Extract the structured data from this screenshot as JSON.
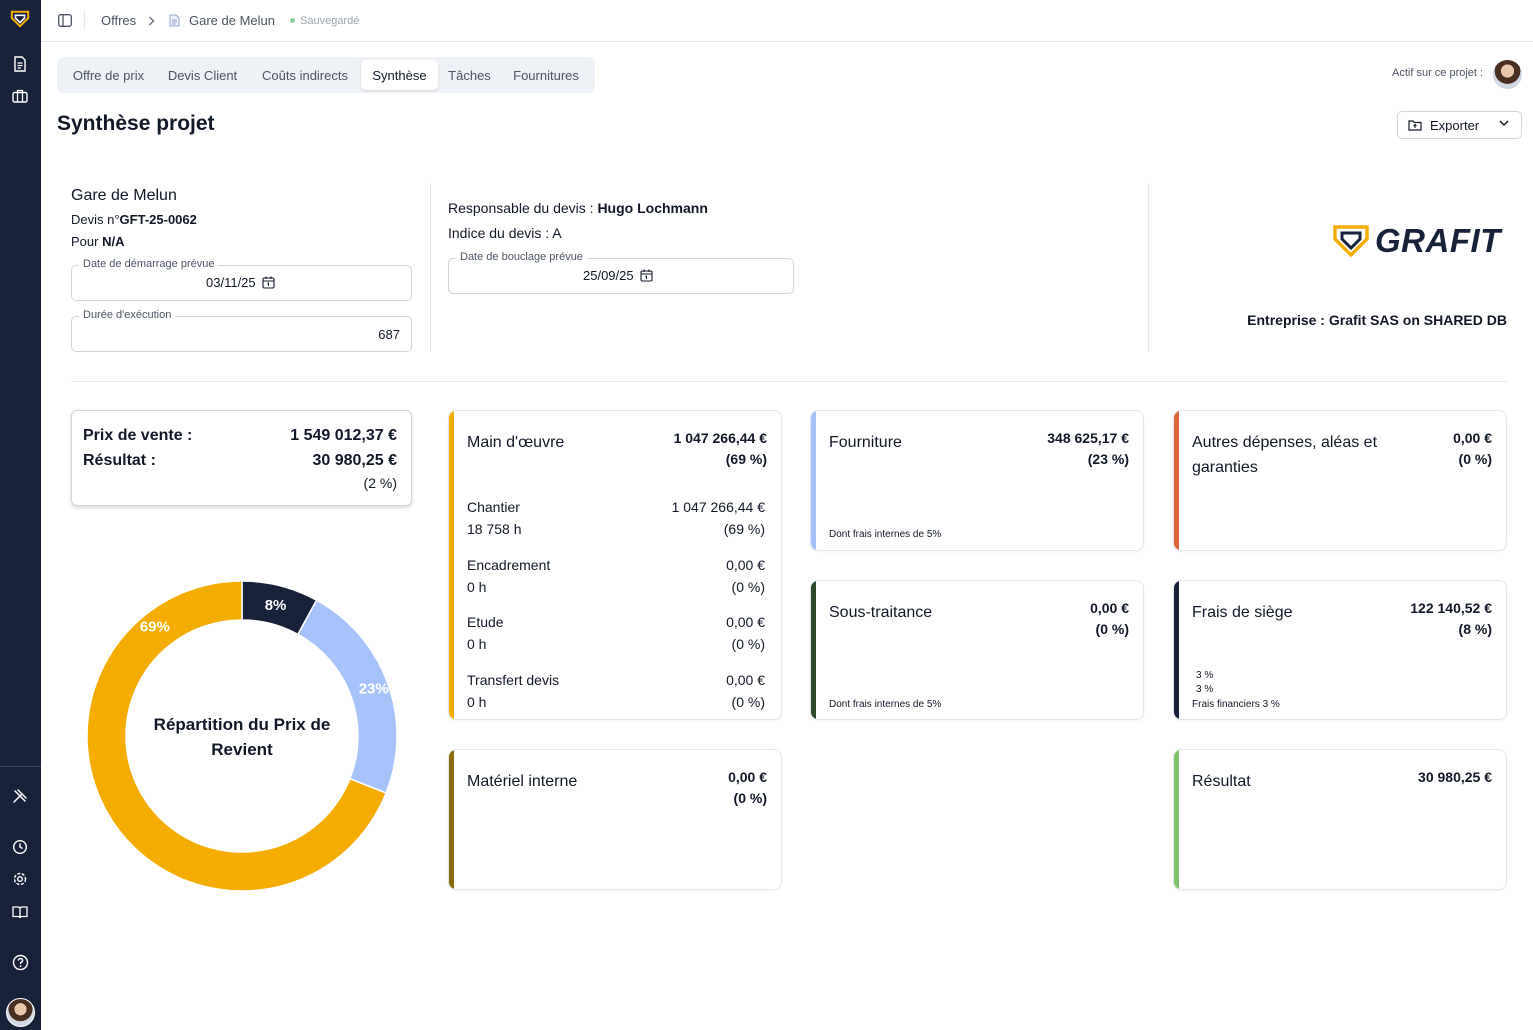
{
  "breadcrumb": {
    "root": "Offres",
    "current": "Gare de Melun",
    "status": "Sauvegardé"
  },
  "tabs": [
    {
      "label": "Offre de prix",
      "active": false
    },
    {
      "label": "Devis Client",
      "active": false
    },
    {
      "label": "Coûts indirects",
      "active": false
    },
    {
      "label": "Synthèse",
      "active": true
    },
    {
      "label": "Tâches",
      "active": false
    },
    {
      "label": "Fournitures",
      "active": false
    }
  ],
  "actif_label": "Actif sur ce projet :",
  "page_title": "Synthèse projet",
  "export_label": "Exporter",
  "project": {
    "name": "Gare de Melun",
    "devis_prefix": "Devis n°",
    "devis_number": "GFT-25-0062",
    "pour_prefix": "Pour",
    "pour_value": "N/A",
    "start_label": "Date de démarrage prévue",
    "start_value": "03/11/25",
    "duration_label": "Durée d'exécution",
    "duration_value": "687",
    "responsable_prefix": "Responsable du devis :",
    "responsable_value": "Hugo Lochmann",
    "indice": "Indice du devis : A",
    "end_label": "Date de bouclage prévue",
    "end_value": "25/09/25",
    "logo_text": "GRAFIT",
    "entreprise": "Entreprise : Grafit SAS on SHARED DB"
  },
  "summary": {
    "prix_label": "Prix de vente :",
    "prix_value": "1 549 012,37 €",
    "resultat_label": "Résultat :",
    "resultat_value": "30 980,25 €",
    "resultat_pct": "(2 %)"
  },
  "chart_data": {
    "type": "pie",
    "title": "Répartition du Prix de Revient",
    "categories": [
      "Frais de siège",
      "Fourniture",
      "Main d'œuvre"
    ],
    "values": [
      8,
      23,
      69
    ],
    "labels": [
      "8%",
      "23%",
      "69%"
    ],
    "colors": [
      "#18213a",
      "#a5c3fa",
      "#f4ad00"
    ],
    "donut": true
  },
  "cards": {
    "main_oeuvre": {
      "title": "Main d'œuvre",
      "value": "1 047 266,44 €",
      "pct": "(69 %)",
      "color": "#f4ad00",
      "rows": [
        {
          "label": "Chantier",
          "sub": "18 758 h",
          "value": "1 047 266,44 €",
          "pct": "(69 %)"
        },
        {
          "label": "Encadrement",
          "sub": "0 h",
          "value": "0,00 €",
          "pct": "(0 %)"
        },
        {
          "label": "Etude",
          "sub": "0 h",
          "value": "0,00 €",
          "pct": "(0 %)"
        },
        {
          "label": "Transfert devis",
          "sub": "0 h",
          "value": "0,00 €",
          "pct": "(0 %)"
        }
      ]
    },
    "fourniture": {
      "title": "Fourniture",
      "value": "348 625,17 €",
      "pct": "(23 %)",
      "note": "Dont frais internes de 5%",
      "color": "#a5c3fa"
    },
    "autres": {
      "title_line1": "Autres dépenses, aléas et",
      "title_line2": "garanties",
      "value": "0,00 €",
      "pct": "(0 %)",
      "color": "#e0663a"
    },
    "sous_traitance": {
      "title": "Sous-traitance",
      "value": "0,00 €",
      "pct": "(0 %)",
      "note": "Dont frais internes de 5%",
      "color": "#2d4a2b"
    },
    "frais_siege": {
      "title": "Frais de siège",
      "value": "122 140,52 €",
      "pct": "(8 %)",
      "note1": "3 %",
      "note2": "3 %",
      "note3": "Frais financiers 3 %",
      "color": "#18213a"
    },
    "materiel": {
      "title": "Matériel interne",
      "value": "0,00 €",
      "pct": "(0 %)",
      "color": "#8a6a0c"
    },
    "resultat": {
      "title": "Résultat",
      "value": "30 980,25 €",
      "color": "#7cc36a"
    }
  }
}
